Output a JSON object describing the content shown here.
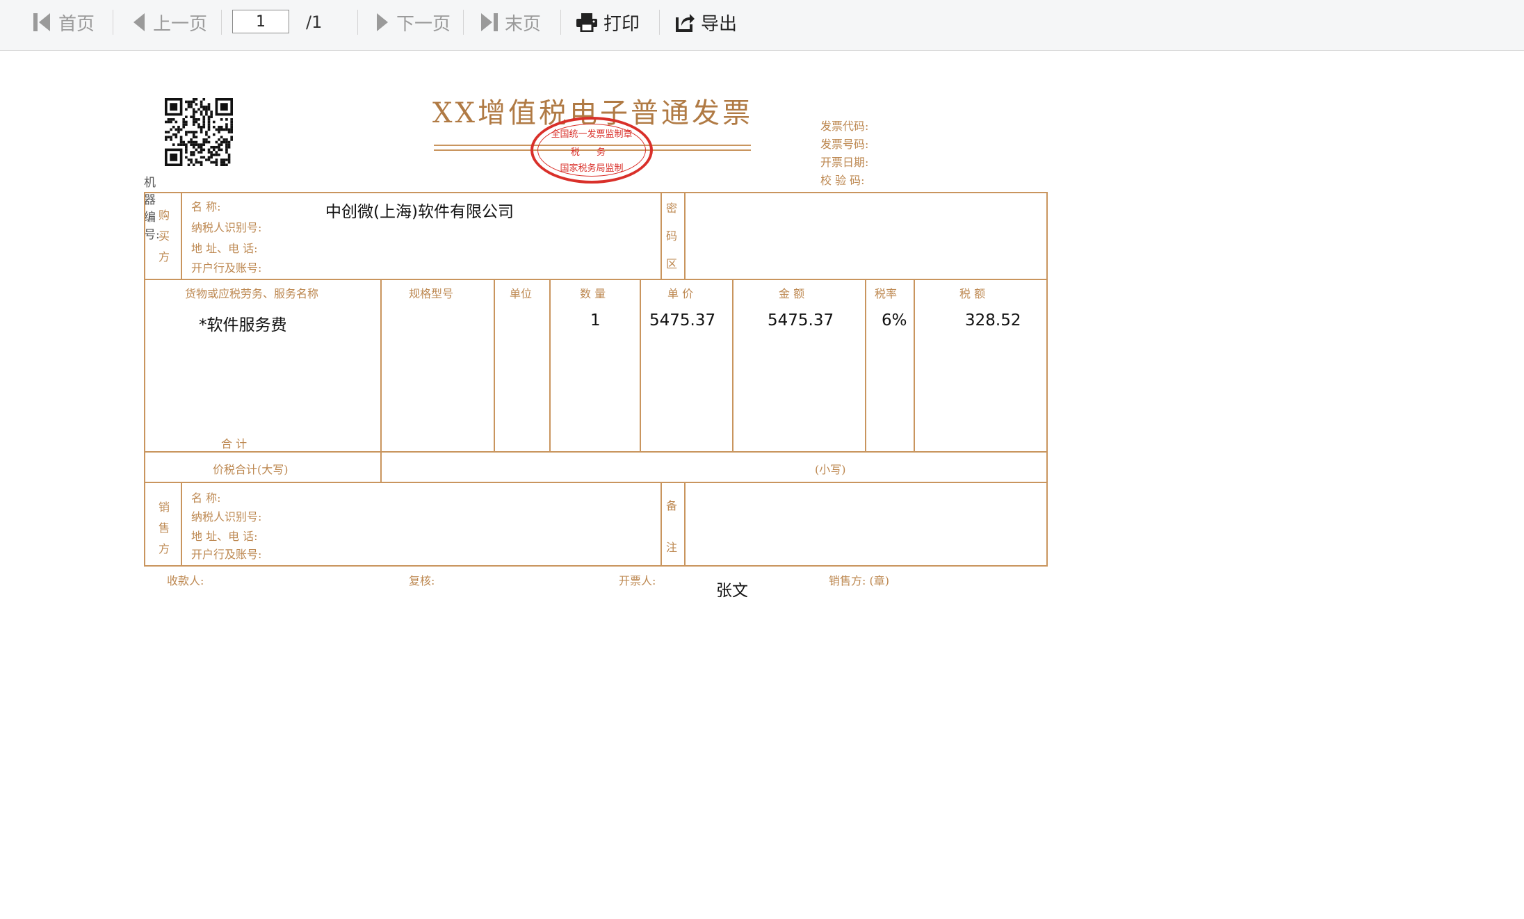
{
  "toolbar": {
    "first_label": "首页",
    "prev_label": "上一页",
    "page_value": "1",
    "page_total": "/1",
    "next_label": "下一页",
    "last_label": "末页",
    "print_label": "打印",
    "export_label": "导出"
  },
  "invoice": {
    "title": "XX增值税电子普通发票",
    "stamp": {
      "top": "全国统一发票监制章",
      "middle": "税 务",
      "bottom": "国家税务局监制",
      "color": "#d9302a"
    },
    "header_fields": [
      "发票代码:",
      "发票号码:",
      "开票日期:",
      "校 验 码:"
    ],
    "machine_no_label": "机器编号:",
    "buyer": {
      "side_label": [
        "购",
        "买",
        "方"
      ],
      "name_label": "名        称:",
      "tax_id_label": "纳税人识别号:",
      "address_label": "地  址、电  话:",
      "bank_label": "开户行及账号:",
      "name_value": "中创微(上海)软件有限公司",
      "cipher_label": [
        "密",
        "码",
        "区"
      ]
    },
    "columns": [
      "货物或应税劳务、服务名称",
      "规格型号",
      "单位",
      "数  量",
      "单  价",
      "金    额",
      "税率",
      "税    额"
    ],
    "items": [
      {
        "name": "*软件服务费",
        "spec": "",
        "unit": "",
        "qty": "1",
        "price": "5475.37",
        "amount": "5475.37",
        "rate": "6%",
        "tax": "328.52"
      }
    ],
    "total_label": "合          计",
    "total_incl_label": "价税合计(大写)",
    "small_label": "(小写)",
    "seller": {
      "side_label": [
        "销",
        "售",
        "方"
      ],
      "name_label": "名        称:",
      "tax_id_label": "纳税人识别号:",
      "address_label": "地  址、电  话:",
      "bank_label": "开户行及账号:",
      "remark_label": [
        "备",
        "注"
      ]
    },
    "footer": {
      "payee_label": "收款人:",
      "reviewer_label": "复核:",
      "drawer_label": "开票人:",
      "drawer_value": "张文",
      "seller_seal_label": "销售方: (章)"
    },
    "line_color": "#c9955e"
  }
}
